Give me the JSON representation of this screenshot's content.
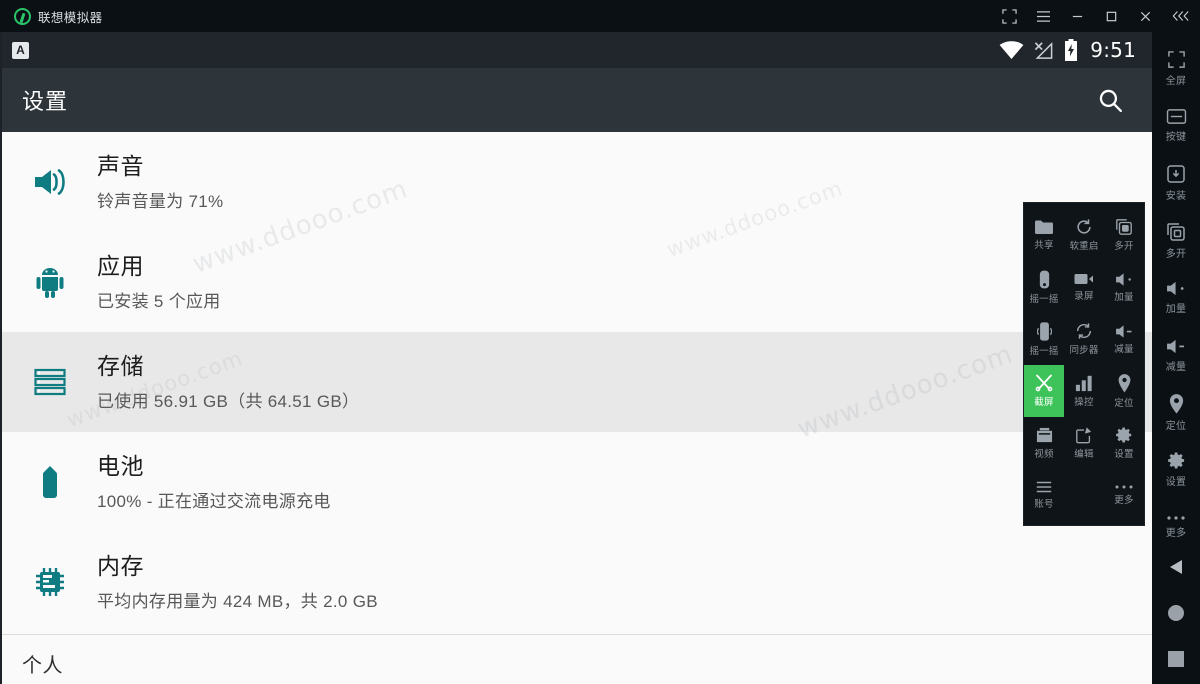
{
  "window": {
    "title": "联想模拟器",
    "controls": [
      {
        "name": "resize-icon",
        "label": "缩放"
      },
      {
        "name": "menu-icon",
        "label": "菜单"
      },
      {
        "name": "minimize-icon",
        "label": "最小化"
      },
      {
        "name": "maximize-icon",
        "label": "最大化"
      },
      {
        "name": "close-icon",
        "label": "关闭"
      },
      {
        "name": "collapse-icon",
        "label": "收起"
      }
    ]
  },
  "statusbar": {
    "app_badge": "A",
    "wifi": "wifi-icon",
    "signal": "no-signal-icon",
    "battery": "battery-charging-icon",
    "clock": "9:51"
  },
  "appbar": {
    "title": "设置",
    "search_icon": "search-icon"
  },
  "settings_rows": [
    {
      "icon": "volume-icon",
      "title": "声音",
      "subtitle": "铃声音量为 71%",
      "selected": false
    },
    {
      "icon": "android-icon",
      "title": "应用",
      "subtitle": "已安装 5 个应用",
      "selected": false
    },
    {
      "icon": "storage-icon",
      "title": "存储",
      "subtitle": "已使用 56.91 GB（共 64.51 GB）",
      "selected": true
    },
    {
      "icon": "battery-icon",
      "title": "电池",
      "subtitle": "100% - 正在通过交流电源充电",
      "selected": false
    },
    {
      "icon": "memory-icon",
      "title": "内存",
      "subtitle": "平均内存用量为 424 MB，共 2.0 GB",
      "selected": false
    }
  ],
  "section": {
    "personal_label": "个人"
  },
  "watermarks": [
    "www.ddooo.com",
    "www.ddooo.com",
    "www.ddooo.com",
    "www.ddooo.com"
  ],
  "sidestrip": [
    {
      "icon": "fullscreen-icon",
      "label": "全屏"
    },
    {
      "icon": "keyboard-icon",
      "label": "按键"
    },
    {
      "icon": "install-apk-icon",
      "label": "安装"
    },
    {
      "icon": "multi-instance-icon",
      "label": "多开"
    },
    {
      "icon": "volume-up-icon",
      "label": "加量"
    },
    {
      "icon": "volume-down-icon",
      "label": "减量"
    },
    {
      "icon": "location-icon",
      "label": "定位"
    },
    {
      "icon": "settings-icon",
      "label": "设置"
    },
    {
      "icon": "more-icon",
      "label": "更多"
    }
  ],
  "sidestrip_nav": [
    {
      "icon": "back-icon",
      "label": "返回"
    },
    {
      "icon": "home-icon",
      "label": "主页"
    },
    {
      "icon": "recents-icon",
      "label": "多任务"
    }
  ],
  "panel": [
    {
      "icon": "share-icon",
      "label": "共享",
      "active": false
    },
    {
      "icon": "restart-icon",
      "label": "软重启",
      "active": false
    },
    {
      "icon": "multi-open-icon",
      "label": "多开",
      "active": false
    },
    {
      "icon": "shake-icon",
      "label": "摇一摇",
      "active": false
    },
    {
      "icon": "record-screen-icon",
      "label": "录屏",
      "active": false
    },
    {
      "icon": "volume-up-icon",
      "label": "加量",
      "active": false
    },
    {
      "icon": "shake-phone-icon",
      "label": "摇一摇",
      "active": false
    },
    {
      "icon": "sync-icon",
      "label": "同步器",
      "active": false
    },
    {
      "icon": "volume-down-icon",
      "label": "减量",
      "active": false
    },
    {
      "icon": "screenshot-icon",
      "label": "截屏",
      "active": true
    },
    {
      "icon": "performance-icon",
      "label": "操控",
      "active": false
    },
    {
      "icon": "location-pin-icon",
      "label": "定位",
      "active": false
    },
    {
      "icon": "video-icon",
      "label": "视频",
      "active": false
    },
    {
      "icon": "edit-icon",
      "label": "编辑",
      "active": false
    },
    {
      "icon": "gear-icon",
      "label": "设置",
      "active": false
    },
    {
      "icon": "list-icon",
      "label": "账号",
      "active": false
    },
    {
      "icon": "empty",
      "label": "",
      "active": false
    },
    {
      "icon": "more-dots-icon",
      "label": "更多",
      "active": false
    }
  ]
}
